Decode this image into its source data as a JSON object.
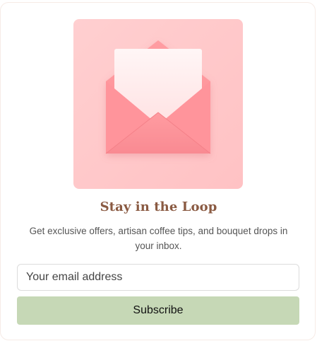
{
  "newsletter": {
    "illustration_icon": "open-envelope-with-letter-icon",
    "title": "Stay in the Loop",
    "description": "Get exclusive offers, artisan coffee tips, and bouquet drops in your inbox.",
    "email_placeholder": "Your email address",
    "email_value": "",
    "subscribe_label": "Subscribe"
  },
  "colors": {
    "illustration_background": "#ffc9ca",
    "envelope": "#ff9aa0",
    "letter": "#fff0f0",
    "title": "#8a5a42",
    "button_background": "#c6d8b6"
  }
}
